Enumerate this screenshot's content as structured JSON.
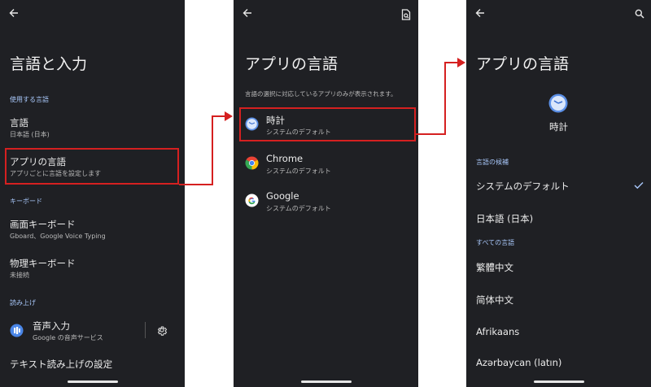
{
  "screen1": {
    "title": "言語と入力",
    "section_languages": "使用する言語",
    "language": {
      "label": "言語",
      "value": "日本語 (日本)"
    },
    "app_languages": {
      "label": "アプリの言語",
      "sub": "アプリごとに言語を設定します"
    },
    "section_keyboard": "キーボード",
    "onscreen_keyboard": {
      "label": "画面キーボード",
      "sub": "Gboard、Google Voice Typing"
    },
    "physical_keyboard": {
      "label": "物理キーボード",
      "sub": "未接続"
    },
    "section_readout": "読み上げ",
    "voice_input": {
      "label": "音声入力",
      "sub": "Google の音声サービス"
    },
    "tts": {
      "label": "テキスト読み上げの設定"
    }
  },
  "screen2": {
    "title": "アプリの言語",
    "description": "言語の選択に対応しているアプリのみが表示されます。",
    "apps": [
      {
        "name": "時計",
        "sub": "システムのデフォルト",
        "icon": "clock-icon"
      },
      {
        "name": "Chrome",
        "sub": "システムのデフォルト",
        "icon": "chrome-icon"
      },
      {
        "name": "Google",
        "sub": "システムのデフォルト",
        "icon": "google-icon"
      }
    ]
  },
  "screen3": {
    "title": "アプリの言語",
    "app_name": "時計",
    "section_suggested": "言語の候補",
    "suggested": [
      "システムのデフォルト",
      "日本語 (日本)"
    ],
    "section_all": "すべての言語",
    "all_languages": [
      "繁體中文",
      "简体中文",
      "Afrikaans",
      "Azərbaycan (latın)"
    ]
  },
  "colors": {
    "background": "#1f2024",
    "accent": "#a8c7fa",
    "highlight": "#d52020"
  }
}
